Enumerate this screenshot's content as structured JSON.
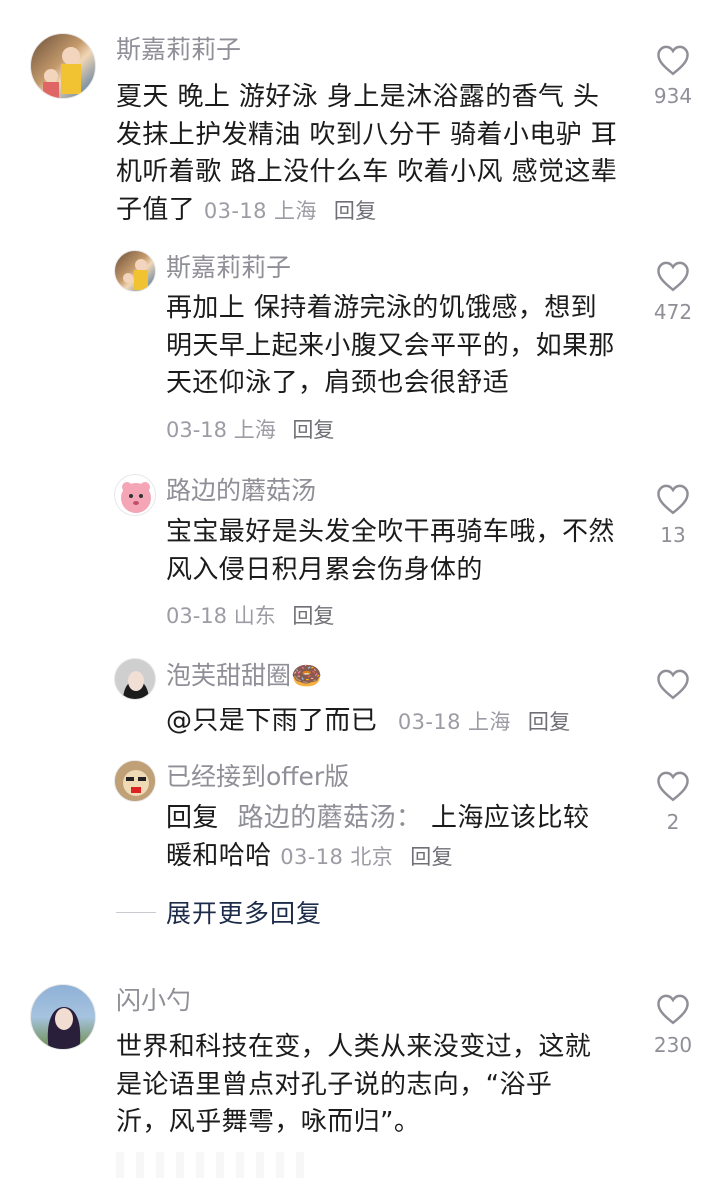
{
  "comments": [
    {
      "user": "斯嘉莉莉子",
      "text": "夏天 晚上 游好泳 身上是沐浴露的香气 头发抹上护发精油 吹到八分干 骑着小电驴 耳机听着歌 路上没什么车 吹着小风 感觉这辈子值了",
      "date": "03-18",
      "location": "上海",
      "reply": "回复",
      "likes": "934"
    },
    {
      "user": "斯嘉莉莉子",
      "text": "再加上 保持着游完泳的饥饿感，想到明天早上起来小腹又会平平的，如果那天还仰泳了，肩颈也会很舒适",
      "date": "03-18",
      "location": "上海",
      "reply": "回复",
      "likes": "472"
    },
    {
      "user": "路边的蘑菇汤",
      "text": "宝宝最好是头发全吹干再骑车哦，不然风入侵日积月累会伤身体的",
      "date": "03-18",
      "location": "山东",
      "reply": "回复",
      "likes": "13"
    },
    {
      "user": "泡芙甜甜圈🍩",
      "text": "@只是下雨了而已",
      "date": "03-18",
      "location": "上海",
      "reply": "回复",
      "likes": ""
    },
    {
      "user": "已经接到offer版",
      "reply_prefix": "回复",
      "reply_target": "路边的蘑菇汤：",
      "text_line1": "上海应该比较",
      "text_line2": "暖和哈哈",
      "date": "03-18",
      "location": "北京",
      "reply": "回复",
      "likes": "2"
    },
    {
      "user": "闪小勺",
      "text": "世界和科技在变，人类从来没变过，这就是论语里曾点对孔子说的志向，“浴乎沂，风乎舞雩，咏而归”。",
      "date": "",
      "location": "",
      "reply": "",
      "likes": "230"
    }
  ],
  "expand_replies": "展开更多回复",
  "icons": {
    "like": "heart-outline-icon"
  },
  "colors": {
    "text": "#1b1b1b",
    "muted": "#8f8f97",
    "expand": "#1d2b4a"
  }
}
